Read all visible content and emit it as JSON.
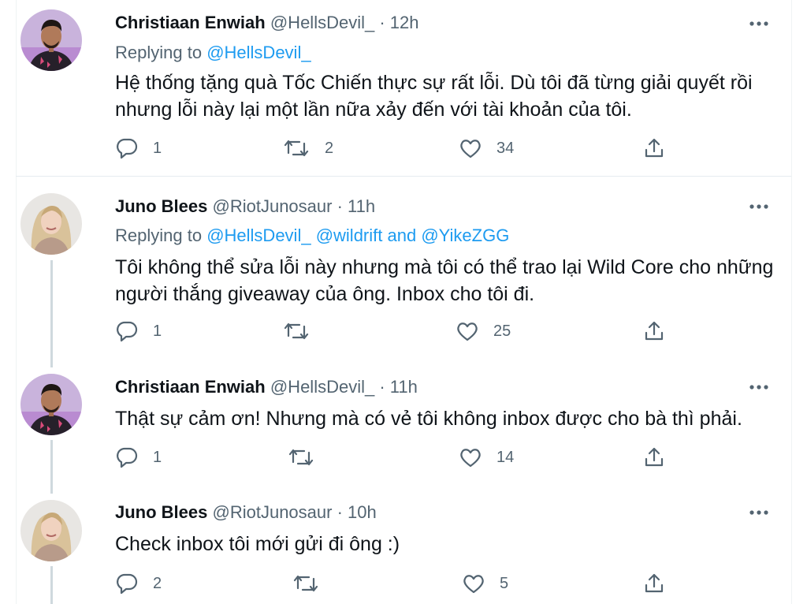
{
  "tweets": [
    {
      "name": "Christiaan Enwiah",
      "handle": "@HellsDevil_",
      "dot": "·",
      "time": "12h",
      "replying_prefix": "Replying to",
      "replying_to": "@HellsDevil_",
      "replying_and": "",
      "replying_extra": "",
      "text": "Hệ thống tặng quà Tốc Chiến thực sự rất lỗi. Dù tôi đã từng giải quyết rồi nhưng lỗi này lại một lần nữa xảy đến với tài khoản của tôi.",
      "replies": "1",
      "retweets": "2",
      "likes": "34"
    },
    {
      "name": "Juno Blees",
      "handle": "@RiotJunosaur",
      "dot": "·",
      "time": "11h",
      "replying_prefix": "Replying to",
      "replying_to": "@HellsDevil_",
      "replying_mid": "@wildrift",
      "replying_and": "and",
      "replying_extra": "@YikeZGG",
      "text": "Tôi không thể sửa lỗi này nhưng mà tôi có thể trao lại Wild Core cho những người thắng giveaway của ông. Inbox cho tôi đi.",
      "replies": "1",
      "retweets": "",
      "likes": "25"
    },
    {
      "name": "Christiaan Enwiah",
      "handle": "@HellsDevil_",
      "dot": "·",
      "time": "11h",
      "text": "Thật sự cảm ơn! Nhưng mà có vẻ tôi không inbox được cho bà thì phải.",
      "replies": "1",
      "retweets": "",
      "likes": "14"
    },
    {
      "name": "Juno Blees",
      "handle": "@RiotJunosaur",
      "dot": "·",
      "time": "10h",
      "text": "Check inbox tôi mới gửi đi ông :)",
      "replies": "2",
      "retweets": "",
      "likes": "5"
    }
  ],
  "icons": {
    "reply": "reply-icon",
    "retweet": "retweet-icon",
    "like": "heart-icon",
    "share": "share-icon",
    "more": "more-icon"
  },
  "colors": {
    "link": "#1d9bf0",
    "text": "#0f1419",
    "muted": "#536471",
    "divider": "#e6ecf0",
    "thread_line": "#cfd9de"
  }
}
